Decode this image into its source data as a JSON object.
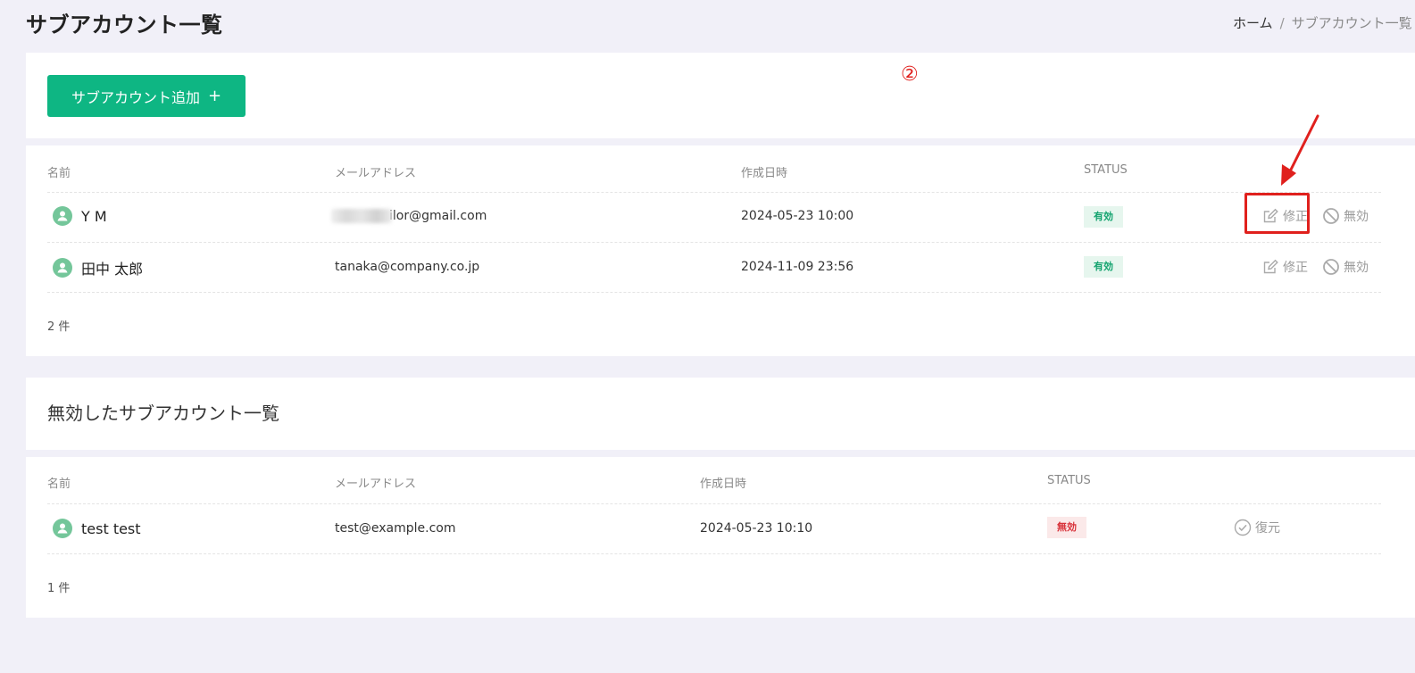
{
  "header": {
    "title": "サブアカウント一覧",
    "breadcrumb": {
      "home": "ホーム",
      "separator": "/",
      "current": "サブアカウント一覧"
    }
  },
  "annotations": {
    "step_number": "②",
    "highlight_color": "#e0201d"
  },
  "active_section": {
    "add_button_label": "サブアカウント追加",
    "add_button_icon": "plus-icon",
    "columns": [
      "名前",
      "メールアドレス",
      "作成日時",
      "STATUS"
    ],
    "rows": [
      {
        "name": "Y M",
        "email": "ilor@gmail.com",
        "created": "2024-05-23 10:00",
        "status": "有効",
        "edit_label": "修正",
        "disable_label": "無効"
      },
      {
        "name": "田中 太郎",
        "email": "tanaka@company.co.jp",
        "created": "2024-11-09 23:56",
        "status": "有効",
        "edit_label": "修正",
        "disable_label": "無効"
      }
    ],
    "count": "2 件"
  },
  "inactive_section": {
    "title": "無効したサブアカウント一覧",
    "columns": [
      "名前",
      "メールアドレス",
      "作成日時",
      "STATUS"
    ],
    "rows": [
      {
        "name": "test test",
        "email": "test@example.com",
        "created": "2024-05-23 10:10",
        "status": "無効",
        "restore_label": "復元"
      }
    ],
    "count": "1 件"
  },
  "colors": {
    "accent": "#0eb683",
    "active_badge": "#12a36e",
    "inactive_badge": "#d8323a",
    "avatar": "#74c69a"
  }
}
